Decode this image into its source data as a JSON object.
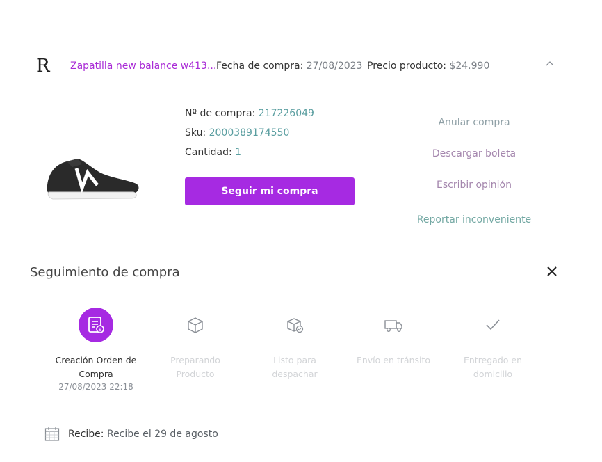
{
  "header": {
    "logo": "R",
    "product_name": "Zapatilla new balance w413...",
    "purchase_date_label": "Fecha de compra:",
    "purchase_date_value": "27/08/2023",
    "price_label": "Precio producto:",
    "price_value": "$24.990",
    "collapse_icon": "chevron-up-icon"
  },
  "product": {
    "image": "shoe-image",
    "order_label": "Nº de compra:",
    "order_value": "217226049",
    "sku_label": "Sku:",
    "sku_value": "2000389174550",
    "qty_label": "Cantidad:",
    "qty_value": "1",
    "track_button": "Seguir mi compra"
  },
  "actions": {
    "cancel": "Anular compra",
    "download": "Descargar boleta",
    "review": "Escribir opinión",
    "report": "Reportar inconveniente"
  },
  "tracking": {
    "title": "Seguimiento de compra",
    "close_icon": "close-icon",
    "steps": [
      {
        "line1": "Creación Orden de",
        "line2": "Compra",
        "date": "27/08/2023 22:18",
        "active": true,
        "icon": "receipt-icon"
      },
      {
        "line1": "Preparando",
        "line2": "Producto",
        "active": false,
        "icon": "box-icon"
      },
      {
        "line1": "Listo para",
        "line2": "despachar",
        "active": false,
        "icon": "package-ready-icon"
      },
      {
        "line1": "Envío en tránsito",
        "line2": "",
        "active": false,
        "icon": "truck-icon"
      },
      {
        "line1": "Entregado en",
        "line2": "domicilio",
        "active": false,
        "icon": "check-icon"
      }
    ]
  },
  "delivery": {
    "icon": "calendar-icon",
    "label": "Recibe:",
    "value": "Recibe el 29 de agosto"
  },
  "colors": {
    "accent": "#a62ae2",
    "product_link": "#a92bd6",
    "value_teal": "#5a9ea0",
    "inactive": "#d2d4d7"
  }
}
